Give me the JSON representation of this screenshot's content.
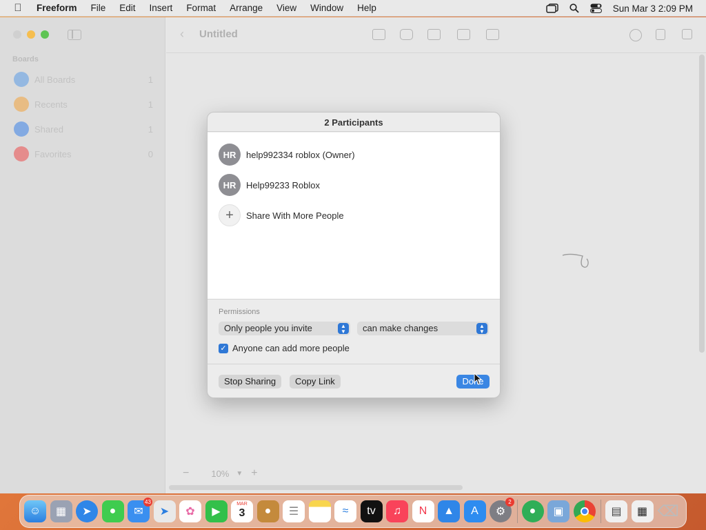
{
  "menubar": {
    "app_name": "Freeform",
    "items": [
      "File",
      "Edit",
      "Insert",
      "Format",
      "Arrange",
      "View",
      "Window",
      "Help"
    ],
    "clock": "Sun Mar 3  2:09 PM"
  },
  "sidebar": {
    "section_title": "Boards",
    "items": [
      {
        "label": "All Boards",
        "count": "1",
        "icon": "all-boards-icon",
        "color": "#5a9be6"
      },
      {
        "label": "Recents",
        "count": "1",
        "icon": "clock-icon",
        "color": "#f2a33a"
      },
      {
        "label": "Shared",
        "count": "1",
        "icon": "people-icon",
        "color": "#3b82e8"
      },
      {
        "label": "Favorites",
        "count": "0",
        "icon": "heart-icon",
        "color": "#ec4b4b"
      }
    ]
  },
  "toolbar": {
    "title": "Untitled"
  },
  "canvas": {
    "zoom_value": "10%"
  },
  "dialog": {
    "title": "2 Participants",
    "participants": [
      {
        "initials": "HR",
        "name": "help992334 roblox (Owner)"
      },
      {
        "initials": "HR",
        "name": "Help99233 Roblox"
      }
    ],
    "share_more_label": "Share With More People",
    "permissions_label": "Permissions",
    "access_value": "Only people you invite",
    "rights_value": "can make changes",
    "checkbox_label": "Anyone can add more people",
    "checkbox_checked": true,
    "stop_sharing_label": "Stop Sharing",
    "copy_link_label": "Copy Link",
    "done_label": "Done"
  },
  "dock": {
    "mail_badge": "43",
    "settings_badge": "2",
    "calendar_month": "MAR",
    "calendar_day": "3"
  },
  "colors": {
    "accent": "#2f78d6",
    "done_button": "#3a86e3"
  }
}
